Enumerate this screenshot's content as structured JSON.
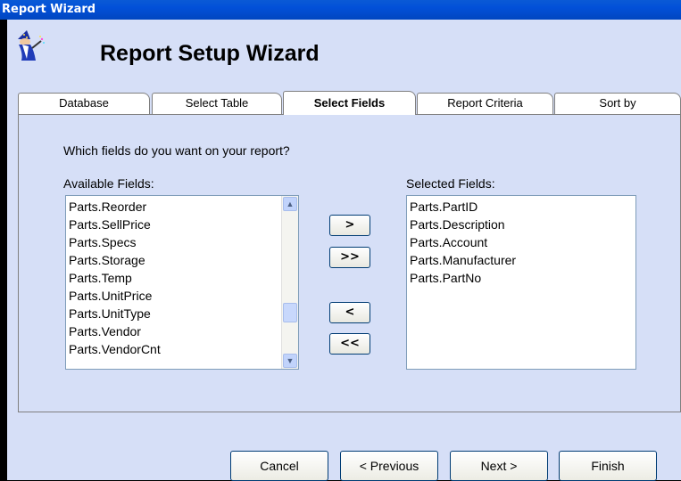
{
  "window": {
    "title": "Report Wizard"
  },
  "header": {
    "title": "Report Setup Wizard",
    "icon": "wizard-icon"
  },
  "tabs": [
    {
      "label": "Database"
    },
    {
      "label": "Select Table"
    },
    {
      "label": "Select Fields",
      "active": true
    },
    {
      "label": "Report Criteria"
    },
    {
      "label": "Sort by"
    }
  ],
  "panel": {
    "question": "Which fields do you want on your report?",
    "available_label": "Available Fields:",
    "selected_label": "Selected Fields:",
    "available_fields": [
      "Parts.Reorder",
      "Parts.SellPrice",
      "Parts.Specs",
      "Parts.Storage",
      "Parts.Temp",
      "Parts.UnitPrice",
      "Parts.UnitType",
      "Parts.Vendor",
      "Parts.VendorCnt"
    ],
    "selected_fields": [
      "Parts.PartID",
      "Parts.Description",
      "Parts.Account",
      "Parts.Manufacturer",
      "Parts.PartNo"
    ],
    "move_buttons": {
      "add_one": ">",
      "add_all": ">>",
      "remove_one": "<",
      "remove_all": "<<"
    }
  },
  "footer": {
    "cancel": "Cancel",
    "previous": "< Previous",
    "next": "Next >",
    "finish": "Finish"
  }
}
